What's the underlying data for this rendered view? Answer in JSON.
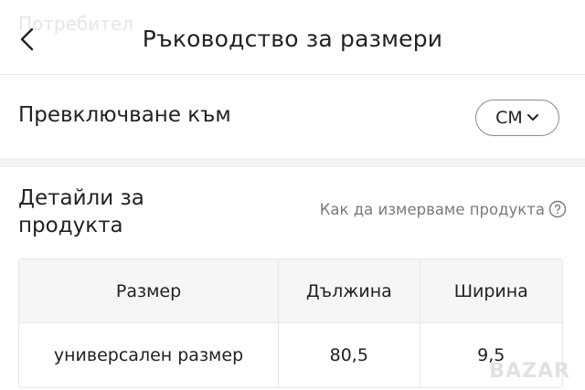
{
  "watermark_text": "Потребител",
  "header": {
    "title": "Ръководство за размери",
    "back_icon": "chevron-left-icon"
  },
  "unit_switch": {
    "label": "Превключване към",
    "value": "СМ",
    "icon": "chevron-down-icon"
  },
  "details": {
    "title": "Детайли за продукта",
    "how_to_measure": "Как да измерваме продукта",
    "help_icon": "question-circle-icon"
  },
  "table": {
    "headers": [
      "Размер",
      "Дължина",
      "Ширина"
    ],
    "rows": [
      [
        "универсален размер",
        "80,5",
        "9,5"
      ]
    ]
  },
  "logo_watermark": "BAZAR"
}
